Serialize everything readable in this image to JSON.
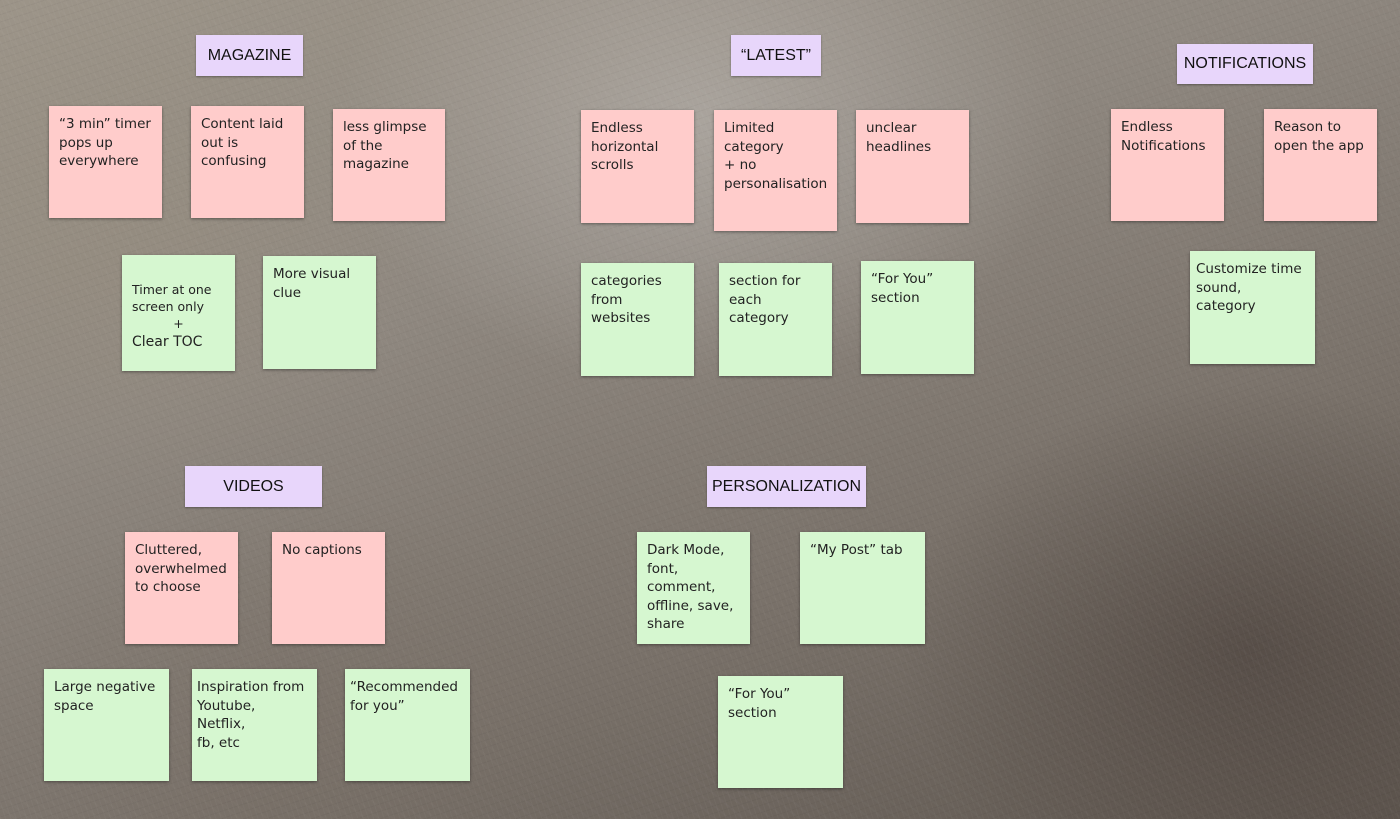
{
  "colors": {
    "header": "#e8d6fb",
    "pain_point_note": "#ffcccb",
    "solution_note": "#d6f7d0"
  },
  "sections": {
    "magazine": {
      "title": "MAGAZINE",
      "pain_points": [
        "“3 min” timer\npops up\neverywhere",
        "Content laid\nout is\nconfusing",
        "less glimpse\nof the\nmagazine"
      ],
      "solutions": [
        "Timer at one\nscreen only\n+\nClear TOC",
        "More visual\nclue"
      ]
    },
    "latest": {
      "title": "“LATEST”",
      "pain_points": [
        "Endless\nhorizontal\nscrolls",
        "Limited\ncategory\n+ no\npersonalisation",
        "unclear\nheadlines"
      ],
      "solutions": [
        "categories\nfrom\nwebsites",
        "section for\neach\ncategory",
        "“For You”\nsection"
      ]
    },
    "notifications": {
      "title": "NOTIFICATIONS",
      "pain_points": [
        "Endless\nNotifications",
        "Reason to\nopen the app"
      ],
      "solutions": [
        "Customize time\nsound, category"
      ]
    },
    "videos": {
      "title": "VIDEOS",
      "pain_points": [
        "Cluttered,\noverwhelmed\nto choose",
        "No captions"
      ],
      "solutions": [
        "Large negative\nspace",
        "Inspiration from\nYoutube, Netflix,\nfb, etc",
        "“Recommended\nfor you”"
      ]
    },
    "personalization": {
      "title": "PERSONALIZATION",
      "solutions": [
        "Dark Mode,\nfont,\ncomment,\noffline, save,\nshare",
        "“My Post” tab",
        "“For You”\nsection"
      ]
    }
  }
}
